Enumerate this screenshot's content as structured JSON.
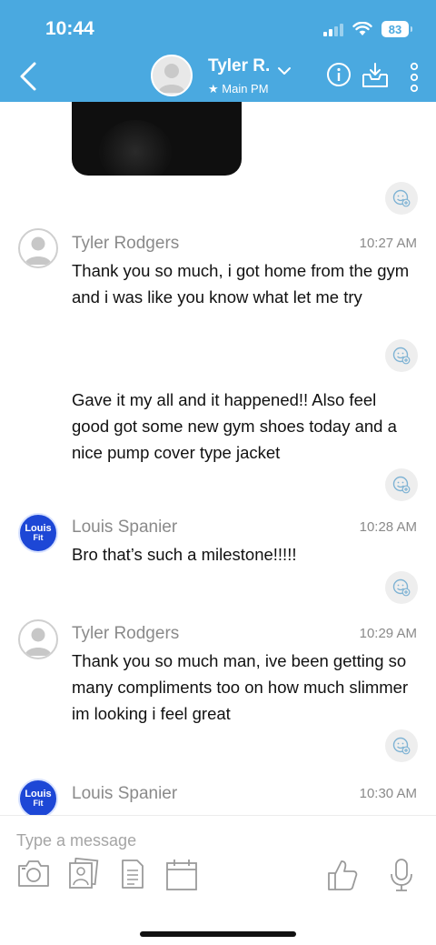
{
  "status_bar": {
    "time": "10:44",
    "battery": "83"
  },
  "header": {
    "contact_name": "Tyler R.",
    "subtitle": "★ Main PM",
    "accent": "#4aa9e0"
  },
  "icons": {
    "back": "chevron-left-icon",
    "info": "info-icon",
    "inbox": "inbox-download-icon",
    "more": "more-vertical-icon",
    "reaction": "add-reaction-icon",
    "camera": "camera-icon",
    "photo": "photo-library-icon",
    "document": "document-icon",
    "calendar": "calendar-icon",
    "thumbs_up": "thumbs-up-icon",
    "mic": "microphone-icon"
  },
  "messages": [
    {
      "sender": "Tyler Rodgers",
      "time": "10:27 AM",
      "avatar": "default",
      "texts": [
        "Thank you so much, i got home from the gym and i was like you know what let me try",
        "Gave it my all and it happened!! Also feel good got some new gym shoes today and a nice pump cover type jacket"
      ]
    },
    {
      "sender": "Louis Spanier",
      "time": "10:28 AM",
      "avatar": "logo",
      "texts": [
        "Bro that’s such a milestone!!!!!"
      ]
    },
    {
      "sender": "Tyler Rodgers",
      "time": "10:29 AM",
      "avatar": "default",
      "texts": [
        "Thank you so much man, ive been getting so many compliments too on how much slimmer im looking i feel great"
      ]
    },
    {
      "sender": "Louis Spanier",
      "time": "10:30 AM",
      "avatar": "logo",
      "texts": []
    }
  ],
  "logo_avatar": {
    "line1": "Louis",
    "line2": "Fit"
  },
  "composer": {
    "placeholder": "Type a message"
  }
}
